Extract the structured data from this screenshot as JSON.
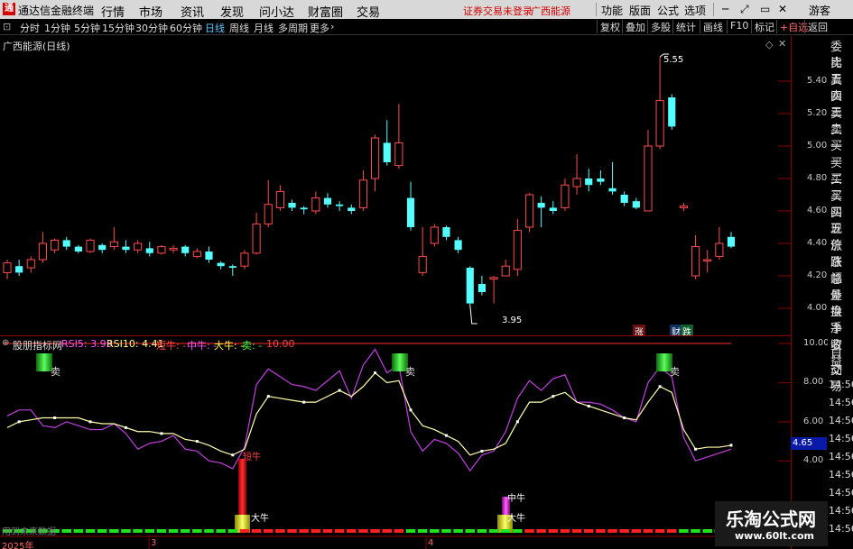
{
  "titlebar": {
    "logo_glyph": "通",
    "app": "通达信金融终端",
    "menus": [
      "行情",
      "市场",
      "资讯",
      "发现",
      "问小达",
      "财富圈",
      "交易"
    ],
    "warning": "证券交易未登录",
    "stock": "广西能源",
    "right_menus": [
      "功能",
      "版面",
      "公式",
      "选项"
    ],
    "guest": "游客"
  },
  "toolbar": {
    "periods": [
      "分时",
      "1分钟",
      "5分钟",
      "15分钟",
      "30分钟",
      "60分钟",
      "日线",
      "周线",
      "月线",
      "多周期",
      "更多"
    ],
    "active": "日线",
    "buttons": [
      "复权",
      "叠加",
      "多股",
      "统计",
      "画线",
      "F10",
      "标记",
      "+自选",
      "返回"
    ]
  },
  "main": {
    "title": "广西能源(日线)",
    "yaxis": [
      "5.40",
      "5.20",
      "5.00",
      "4.80",
      "4.60",
      "4.40",
      "4.20",
      "4.00"
    ],
    "high_label": "5.55",
    "low_label": "3.95",
    "tag_up": "涨",
    "tag_fin": "财",
    "tag_down": "跌"
  },
  "sub": {
    "indicator": "股朋指标网",
    "rsi5": "RSI5: 3.93",
    "rsi10": "RSI10: 4.41",
    "short": "短牛: -",
    "mid": "中牛: -",
    "big": "大牛: -",
    "sell": "卖: -",
    "ten": "10.00",
    "yaxis": [
      "10.00",
      "8.00",
      "6.00",
      "4.00"
    ],
    "sell_label": "卖",
    "lbl_short": "短牛",
    "lbl_mid": "中牛",
    "lbl_big": "大牛",
    "foot_left": "用到未来数据",
    "year": "2025年",
    "m3": "3",
    "m4": "4",
    "value_box": "4.65"
  },
  "right_panel": {
    "labels": [
      "委比",
      "卖五",
      "卖四",
      "卖三",
      "卖二",
      "卖一",
      "买一",
      "买二",
      "买三",
      "买四",
      "买五",
      "现价",
      "涨跌",
      "涨幅",
      "总量",
      "外盘",
      "换手",
      "净资",
      "收益"
    ],
    "sub_labels": [
      "自动",
      "交易"
    ],
    "times": [
      "14:56",
      "14:56",
      "14:56",
      "14:56",
      "14:56",
      "14:56",
      "14:56",
      "14:56",
      "14:56"
    ]
  },
  "watermark": {
    "title": "乐淘公式网",
    "url": "www.60lt.com"
  },
  "chart_data": [
    {
      "type": "candlestick",
      "title": "广西能源(日线)",
      "ylim": [
        3.9,
        5.6
      ],
      "candles": [
        [
          4.22,
          4.28,
          4.18,
          4.3
        ],
        [
          4.26,
          4.22,
          4.2,
          4.3
        ],
        [
          4.25,
          4.3,
          4.22,
          4.32
        ],
        [
          4.3,
          4.4,
          4.28,
          4.47
        ],
        [
          4.36,
          4.42,
          4.34,
          4.43
        ],
        [
          4.42,
          4.38,
          4.36,
          4.44
        ],
        [
          4.38,
          4.35,
          4.34,
          4.39
        ],
        [
          4.35,
          4.42,
          4.34,
          4.43
        ],
        [
          4.39,
          4.36,
          4.34,
          4.4
        ],
        [
          4.38,
          4.41,
          4.36,
          4.5
        ],
        [
          4.38,
          4.36,
          4.34,
          4.42
        ],
        [
          4.36,
          4.4,
          4.34,
          4.42
        ],
        [
          4.37,
          4.34,
          4.32,
          4.41
        ],
        [
          4.34,
          4.38,
          4.33,
          4.39
        ],
        [
          4.36,
          4.37,
          4.34,
          4.39
        ],
        [
          4.38,
          4.34,
          4.32,
          4.39
        ],
        [
          4.32,
          4.35,
          4.31,
          4.37
        ],
        [
          4.35,
          4.3,
          4.28,
          4.38
        ],
        [
          4.28,
          4.26,
          4.24,
          4.29
        ],
        [
          4.26,
          4.25,
          4.2,
          4.27
        ],
        [
          4.26,
          4.34,
          4.24,
          4.36
        ],
        [
          4.34,
          4.52,
          4.33,
          4.59
        ],
        [
          4.52,
          4.64,
          4.5,
          4.79
        ],
        [
          4.62,
          4.72,
          4.6,
          4.76
        ],
        [
          4.65,
          4.62,
          4.6,
          4.67
        ],
        [
          4.62,
          4.61,
          4.58,
          4.63
        ],
        [
          4.6,
          4.68,
          4.58,
          4.72
        ],
        [
          4.68,
          4.64,
          4.62,
          4.71
        ],
        [
          4.64,
          4.63,
          4.6,
          4.66
        ],
        [
          4.62,
          4.6,
          4.58,
          4.64
        ],
        [
          4.62,
          4.79,
          4.6,
          4.85
        ],
        [
          4.8,
          5.05,
          4.72,
          5.07
        ],
        [
          5.02,
          4.9,
          4.88,
          5.16
        ],
        [
          4.88,
          5.02,
          4.86,
          5.26
        ],
        [
          4.68,
          4.5,
          4.48,
          4.78
        ],
        [
          4.22,
          4.32,
          4.2,
          4.5
        ],
        [
          4.4,
          4.5,
          4.38,
          4.52
        ],
        [
          4.5,
          4.44,
          4.42,
          4.51
        ],
        [
          4.42,
          4.36,
          4.34,
          4.44
        ],
        [
          4.25,
          4.03,
          4.02,
          4.26
        ],
        [
          4.15,
          4.1,
          4.08,
          4.2
        ],
        [
          4.18,
          4.19,
          4.03,
          4.2
        ],
        [
          4.2,
          4.26,
          4.2,
          4.3
        ],
        [
          4.24,
          4.48,
          4.2,
          4.55
        ],
        [
          4.5,
          4.7,
          4.47,
          4.71
        ],
        [
          4.65,
          4.62,
          4.5,
          4.69
        ],
        [
          4.62,
          4.6,
          4.58,
          4.66
        ],
        [
          4.62,
          4.76,
          4.6,
          4.8
        ],
        [
          4.75,
          4.8,
          4.7,
          4.95
        ],
        [
          4.8,
          4.76,
          4.72,
          4.86
        ],
        [
          4.8,
          4.78,
          4.76,
          4.85
        ],
        [
          4.74,
          4.72,
          4.7,
          4.9
        ],
        [
          4.7,
          4.65,
          4.63,
          4.72
        ],
        [
          4.66,
          4.62,
          4.61,
          4.68
        ],
        [
          4.6,
          5.0,
          4.6,
          5.1
        ],
        [
          5.0,
          5.28,
          4.98,
          5.55
        ],
        [
          5.3,
          5.12,
          5.1,
          5.32
        ],
        [
          4.62,
          4.63,
          4.6,
          4.65
        ],
        [
          4.2,
          4.38,
          4.18,
          4.45
        ],
        [
          4.3,
          4.3,
          4.22,
          4.36
        ],
        [
          4.32,
          4.4,
          4.3,
          4.5
        ],
        [
          4.44,
          4.38,
          4.37,
          4.47
        ]
      ]
    },
    {
      "type": "line",
      "title": "股朋指标网",
      "ylim": [
        3,
        10
      ],
      "series": [
        {
          "name": "RSI5",
          "values": [
            6.3,
            6.6,
            6.6,
            5.8,
            5.7,
            6.0,
            5.8,
            5.6,
            5.6,
            5.9,
            5.4,
            4.6,
            4.9,
            5.0,
            5.3,
            4.6,
            4.5,
            4.0,
            3.9,
            3.6,
            4.7,
            7.9,
            8.7,
            8.3,
            7.9,
            7.8,
            7.6,
            8.1,
            8.6,
            7.2,
            8.9,
            9.7,
            8.5,
            8.9,
            5.5,
            4.5,
            5.1,
            4.9,
            4.4,
            3.5,
            4.3,
            4.5,
            5.5,
            7.2,
            8.1,
            7.6,
            8.2,
            8.4,
            7.0,
            7.0,
            6.9,
            6.6,
            6.2,
            6.0,
            8.0,
            8.8,
            8.3,
            5.2,
            4.0,
            4.2,
            4.4,
            4.6
          ]
        },
        {
          "name": "RSI10",
          "values": [
            5.7,
            6.0,
            6.1,
            6.2,
            6.2,
            6.2,
            6.2,
            6.0,
            5.9,
            5.9,
            5.7,
            5.5,
            5.5,
            5.4,
            5.4,
            5.1,
            5.0,
            4.8,
            4.5,
            4.3,
            4.6,
            6.4,
            7.3,
            7.2,
            7.1,
            7.0,
            7.0,
            7.3,
            7.6,
            7.3,
            7.8,
            8.5,
            8.0,
            8.1,
            6.6,
            5.8,
            5.6,
            5.3,
            5.0,
            4.3,
            4.5,
            4.6,
            4.9,
            6.0,
            7.0,
            7.0,
            7.3,
            7.5,
            7.0,
            6.8,
            6.6,
            6.4,
            6.2,
            6.1,
            7.0,
            7.8,
            7.5,
            5.6,
            4.6,
            4.7,
            4.7,
            4.8
          ]
        }
      ]
    }
  ]
}
